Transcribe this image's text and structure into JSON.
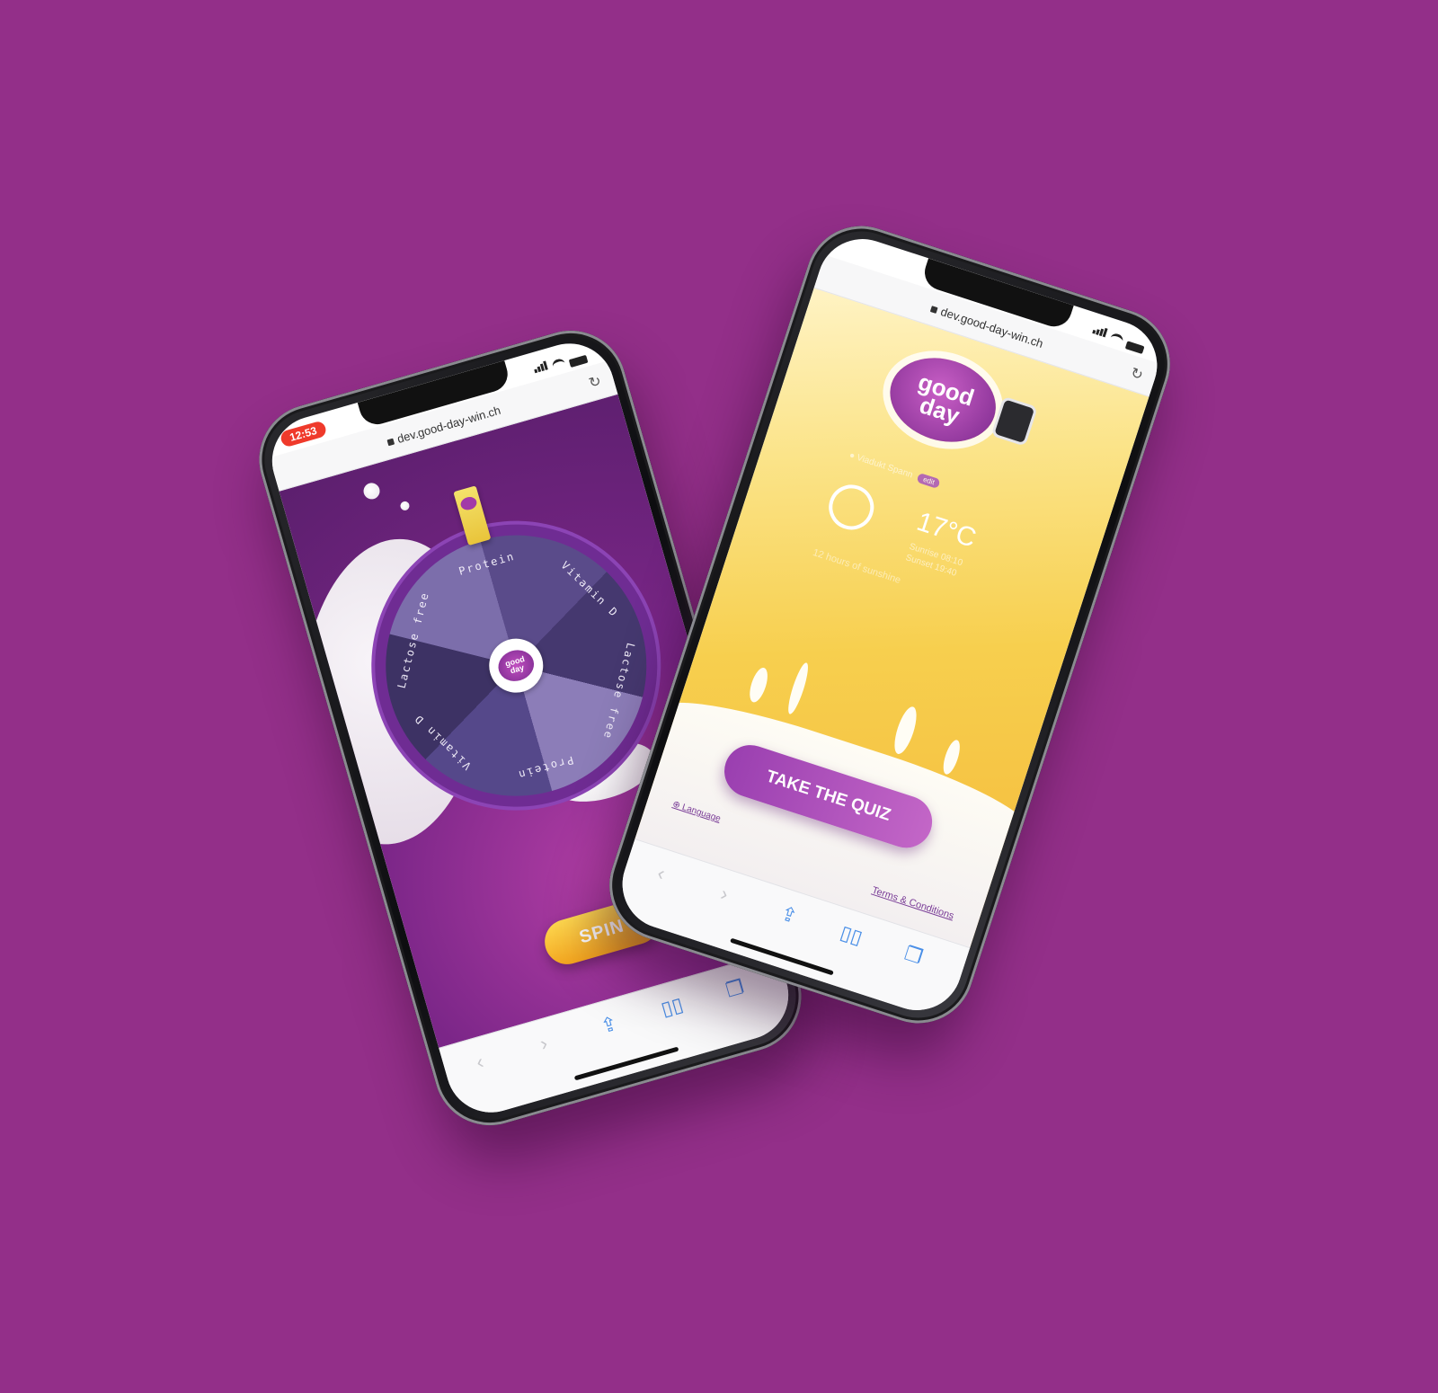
{
  "phone_left": {
    "status_time": "12:53",
    "url": "dev.good-day-win.ch",
    "wheel_segments": [
      "Protein",
      "Vitamin D",
      "Lactose free",
      "Protein",
      "Vitamin D",
      "Lactose free"
    ],
    "hub_logo": [
      "good",
      "day"
    ],
    "spin_label": "SPIN"
  },
  "phone_right": {
    "url": "dev.good-day-win.ch",
    "logo": [
      "good",
      "day"
    ],
    "location_label": "Viadukt Spann",
    "edit_label": "edit",
    "temperature": "17°C",
    "sunrise": "Sunrise 08:10",
    "sunset": "Sunset 19:40",
    "sunshine": "12 hours of sunshine",
    "quiz_label": "TAKE THE QUIZ",
    "language_label": "Language",
    "terms_label": "Terms & Conditions"
  },
  "colors": {
    "background": "#932f89",
    "spin_button": "#f4a51e",
    "quiz_button": "#9a3fb0",
    "link": "#7a3d97"
  },
  "icons": [
    "lock-icon",
    "reload-icon",
    "back-icon",
    "forward-icon",
    "share-icon",
    "bookmarks-icon",
    "tabs-icon",
    "sun-icon",
    "globe-icon",
    "location-pin-icon"
  ]
}
